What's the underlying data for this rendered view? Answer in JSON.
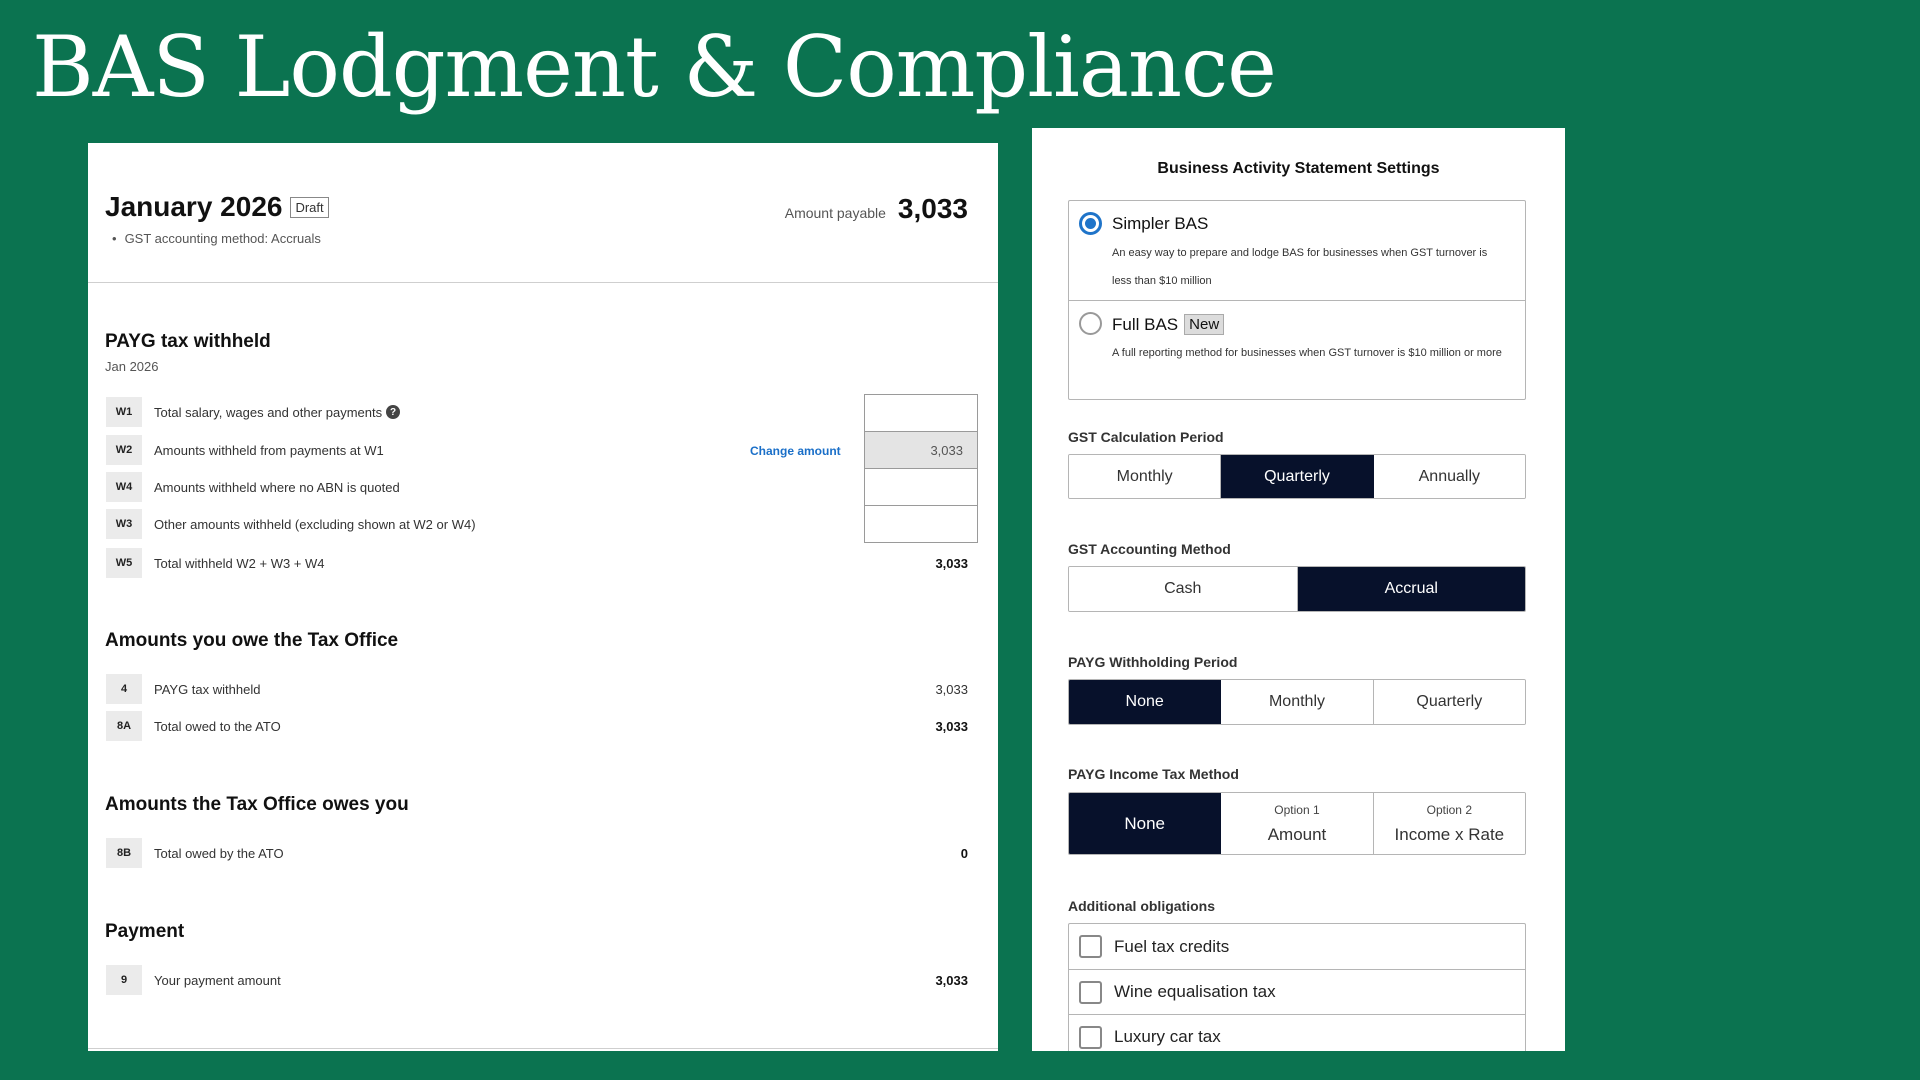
{
  "slide": {
    "title": "BAS Lodgment & Compliance"
  },
  "statement": {
    "title": "January 2026",
    "status": "Draft",
    "method_bullet": "•",
    "method_text": "GST accounting method: Accruals",
    "amount_label": "Amount payable",
    "amount_value": "3,033"
  },
  "payg": {
    "title": "PAYG tax withheld",
    "period": "Jan 2026",
    "rows": [
      {
        "code": "W1",
        "label": "Total salary, wages and other payments",
        "value": ""
      },
      {
        "code": "W2",
        "label": "Amounts withheld from payments at W1",
        "value": "3,033"
      },
      {
        "code": "W4",
        "label": "Amounts withheld where no ABN is quoted",
        "value": ""
      },
      {
        "code": "W3",
        "label": "Other amounts withheld (excluding shown at W2 or W4)",
        "value": ""
      },
      {
        "code": "W5",
        "label": "Total withheld W2 + W3 + W4",
        "value": "3,033"
      }
    ],
    "change_link": "Change amount",
    "help_icon": "?"
  },
  "owe": {
    "title": "Amounts you owe the Tax Office",
    "rows": [
      {
        "code": "4",
        "label": "PAYG tax withheld",
        "value": "3,033"
      },
      {
        "code": "8A",
        "label": "Total owed to the ATO",
        "value": "3,033"
      }
    ]
  },
  "owed": {
    "title": "Amounts the Tax Office owes you",
    "rows": [
      {
        "code": "8B",
        "label": "Total owed by the ATO",
        "value": "0"
      }
    ]
  },
  "payment": {
    "title": "Payment",
    "rows": [
      {
        "code": "9",
        "label": "Your payment amount",
        "value": "3,033"
      }
    ]
  },
  "settings": {
    "title": "Business Activity Statement Settings",
    "bas_types": [
      {
        "label": "Simpler BAS",
        "badge": "",
        "desc": "An easy way to prepare and lodge BAS for businesses when GST turnover is less than $10 million",
        "selected": true
      },
      {
        "label": "Full BAS",
        "badge": "New",
        "desc": "A full reporting method for businesses when GST turnover is $10 million or more",
        "selected": false
      }
    ],
    "gst_period": {
      "label": "GST Calculation Period",
      "options": [
        "Monthly",
        "Quarterly",
        "Annually"
      ],
      "selected": "Quarterly"
    },
    "gst_method": {
      "label": "GST Accounting Method",
      "options": [
        "Cash",
        "Accrual"
      ],
      "selected": "Accrual"
    },
    "payg_period": {
      "label": "PAYG Withholding Period",
      "options": [
        "None",
        "Monthly",
        "Quarterly"
      ],
      "selected": "None"
    },
    "payg_method": {
      "label": "PAYG Income Tax Method",
      "options": [
        {
          "sub": "",
          "main": "None"
        },
        {
          "sub": "Option 1",
          "main": "Amount"
        },
        {
          "sub": "Option 2",
          "main": "Income x Rate"
        }
      ],
      "selected": "None"
    },
    "additional": {
      "label": "Additional obligations",
      "items": [
        {
          "label": "Fuel tax credits",
          "checked": false
        },
        {
          "label": "Wine equalisation tax",
          "checked": false
        },
        {
          "label": "Luxury car tax",
          "checked": false
        }
      ]
    }
  },
  "colors": {
    "background": "#0b7350",
    "active": "#07112b",
    "radio": "#1f74c9",
    "link": "#1a6fc8"
  }
}
